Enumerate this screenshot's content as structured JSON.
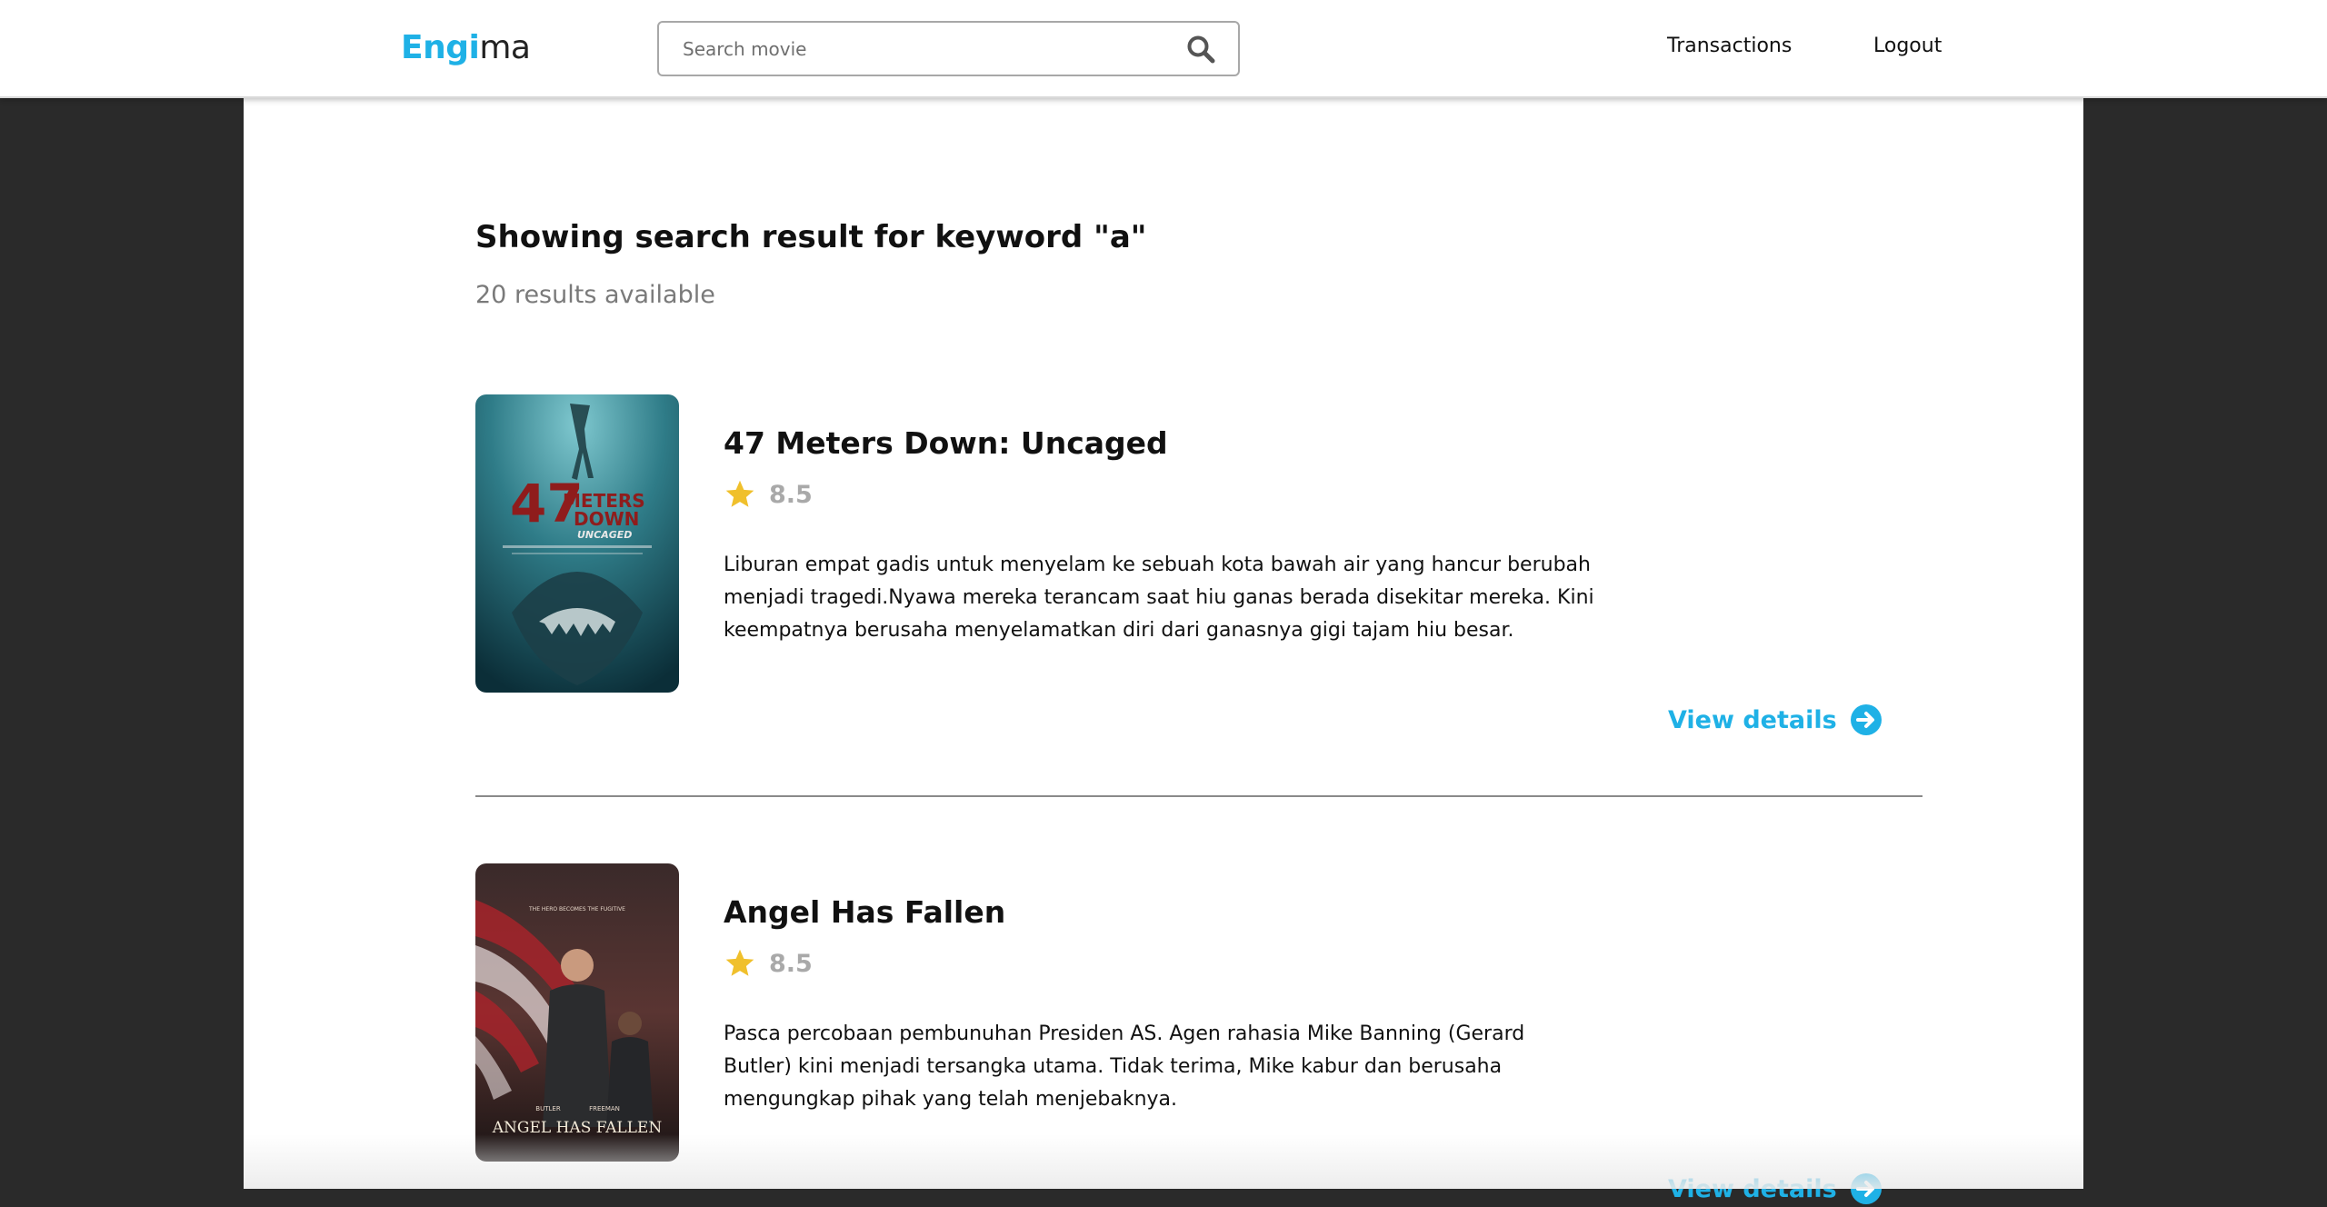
{
  "app": {
    "logo_part1": "Engi",
    "logo_part2": "ma",
    "accent_color": "#1fb1e6"
  },
  "search": {
    "placeholder": "Search movie",
    "value": "",
    "icon": "search-icon"
  },
  "nav": {
    "transactions": "Transactions",
    "logout": "Logout"
  },
  "results": {
    "heading": "Showing search result for keyword \"a\"",
    "count_text": "20 results available"
  },
  "movies": [
    {
      "title": "47 Meters Down: Uncaged",
      "rating": "8.5",
      "synopsis": "Liburan empat gadis untuk menyelam ke sebuah kota bawah air yang hancur berubah menjadi tragedi.Nyawa mereka terancam saat hiu ganas berada disekitar mereka. Kini keempatnya berusaha menyelamatkan diri dari ganasnya gigi tajam hiu besar.",
      "details_label": "View details",
      "poster_text_number": "47",
      "poster_text_top": "METERS",
      "poster_text_mid": "DOWN",
      "poster_text_sub": "UNCAGED"
    },
    {
      "title": "Angel Has Fallen",
      "rating": "8.5",
      "synopsis": "Pasca percobaan pembunuhan Presiden AS. Agen rahasia Mike Banning (Gerard Butler) kini menjadi tersangka utama. Tidak terima, Mike kabur dan berusaha mengungkap pihak yang telah menjebaknya.",
      "details_label": "View details",
      "poster_tagline": "THE HERO BECOMES THE FUGITIVE",
      "poster_name1": "BUTLER",
      "poster_name2": "FREEMAN",
      "poster_title": "ANGEL HAS FALLEN"
    }
  ]
}
